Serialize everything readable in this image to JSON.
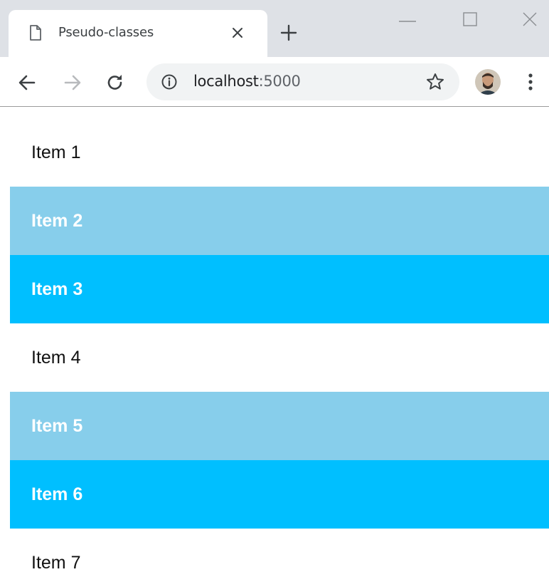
{
  "browser": {
    "tab_title": "Pseudo-classes",
    "url_host": "localhost",
    "url_port": ":5000",
    "icons": {
      "page": "page-icon",
      "close": "close-icon",
      "new_tab": "plus-icon",
      "minimize": "minimize-icon",
      "maximize": "maximize-icon",
      "window_close": "close-icon",
      "back": "arrow-left-icon",
      "forward": "arrow-right-icon",
      "reload": "reload-icon",
      "info": "info-icon",
      "bookmark": "star-icon",
      "menu": "kebab-menu-icon"
    }
  },
  "colors": {
    "light_row": "#87ceeb",
    "deep_row": "#00bfff",
    "plain_row": "#ffffff"
  },
  "list": {
    "items": [
      {
        "label": "Item 1",
        "style": "plain"
      },
      {
        "label": "Item 2",
        "style": "light"
      },
      {
        "label": "Item 3",
        "style": "deep"
      },
      {
        "label": "Item 4",
        "style": "plain"
      },
      {
        "label": "Item 5",
        "style": "light"
      },
      {
        "label": "Item 6",
        "style": "deep"
      },
      {
        "label": "Item 7",
        "style": "plain"
      }
    ]
  }
}
